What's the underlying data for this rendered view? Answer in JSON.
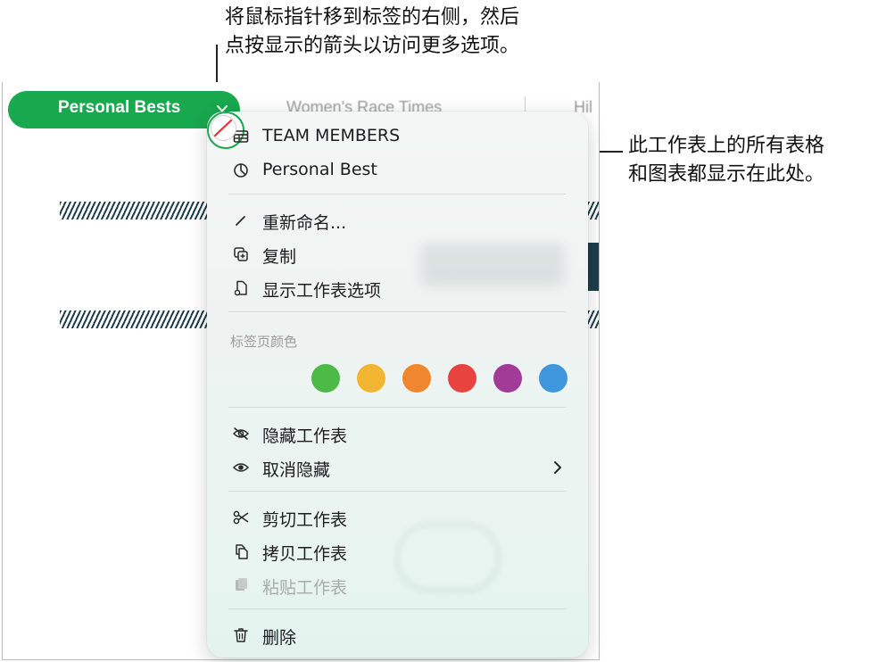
{
  "callouts": {
    "top_line1": "将鼠标指针移到标签的右侧，然后",
    "top_line2": "点按显示的箭头以访问更多选项。",
    "right_line1": "此工作表上的所有表格",
    "right_line2": "和图表都显示在此处。"
  },
  "tabs": {
    "active": "Personal Bests",
    "second": "Women's Race Times",
    "third": "Hil"
  },
  "menu": {
    "objects": [
      {
        "label": "TEAM MEMBERS",
        "icon": "table-icon"
      },
      {
        "label": "Personal Best",
        "icon": "chart-icon"
      }
    ],
    "actions": [
      {
        "label": "重新命名...",
        "icon": "pencil-icon"
      },
      {
        "label": "复制",
        "icon": "duplicate-icon"
      },
      {
        "label": "显示工作表选项",
        "icon": "sheet-options-icon"
      }
    ],
    "tab_color_label": "标签页颜色",
    "colors": [
      "none",
      "#4cba46",
      "#f2b632",
      "#f0862e",
      "#e8433e",
      "#a23b97",
      "#3e96dc"
    ],
    "visibility": [
      {
        "label": "隐藏工作表",
        "icon": "eye-slash-icon"
      },
      {
        "label": "取消隐藏",
        "icon": "eye-icon",
        "has_submenu": true
      }
    ],
    "clipboard": [
      {
        "label": "剪切工作表",
        "icon": "scissors-icon"
      },
      {
        "label": "拷贝工作表",
        "icon": "copy-icon"
      },
      {
        "label": "粘贴工作表",
        "icon": "paste-icon",
        "disabled": true
      }
    ],
    "delete": {
      "label": "删除",
      "icon": "trash-icon"
    }
  }
}
